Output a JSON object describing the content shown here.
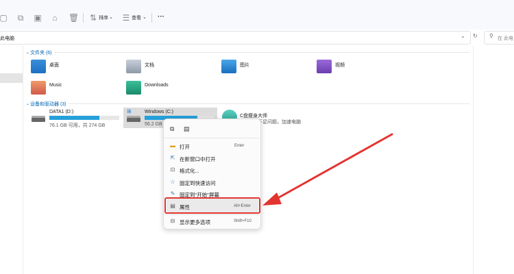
{
  "toolbar": {
    "sort_label": "排序",
    "view_label": "查看",
    "more_label": "···"
  },
  "address": {
    "path": "此电脑",
    "search_placeholder": "在 此电"
  },
  "folders": {
    "header": "文件夹 (6)",
    "items": [
      {
        "label": "桌面",
        "icon": "desktop-folder-icon"
      },
      {
        "label": "文档",
        "icon": "documents-folder-icon"
      },
      {
        "label": "图片",
        "icon": "pictures-folder-icon"
      },
      {
        "label": "视频",
        "icon": "videos-folder-icon"
      },
      {
        "label": "Music",
        "icon": "music-folder-icon"
      },
      {
        "label": "Downloads",
        "icon": "downloads-folder-icon"
      }
    ]
  },
  "drives": {
    "header": "设备和驱动器 (3)",
    "items": [
      {
        "name": "DATA1 (D:)",
        "info": "76.1 GB 可用，共 274 GB",
        "used_fraction": 0.72
      },
      {
        "name": "Windows (C:)",
        "info": "56.2 GB",
        "used_fraction": 0.75
      },
      {
        "name": "C盘瘦身大师",
        "info": "C盘空间不足问题，加速电脑"
      }
    ]
  },
  "context_menu": {
    "items": [
      {
        "label": "打开",
        "shortcut": "Enter",
        "icon": "open-icon"
      },
      {
        "label": "在新窗口中打开",
        "shortcut": "",
        "icon": "new-window-icon"
      },
      {
        "label": "格式化...",
        "shortcut": "",
        "icon": "format-icon"
      },
      {
        "label": "固定到快速访问",
        "shortcut": "",
        "icon": "pin-star-icon"
      },
      {
        "label": "固定到\"开始\"屏幕",
        "shortcut": "",
        "icon": "pin-icon"
      },
      {
        "label": "属性",
        "shortcut": "Alt+Enter",
        "icon": "properties-icon"
      },
      {
        "label": "显示更多选项",
        "shortcut": "Shift+F10",
        "icon": "more-options-icon"
      }
    ]
  },
  "colors": {
    "accent": "#0062b0",
    "highlight_red": "#e3342f",
    "progress": "#26a0da"
  }
}
